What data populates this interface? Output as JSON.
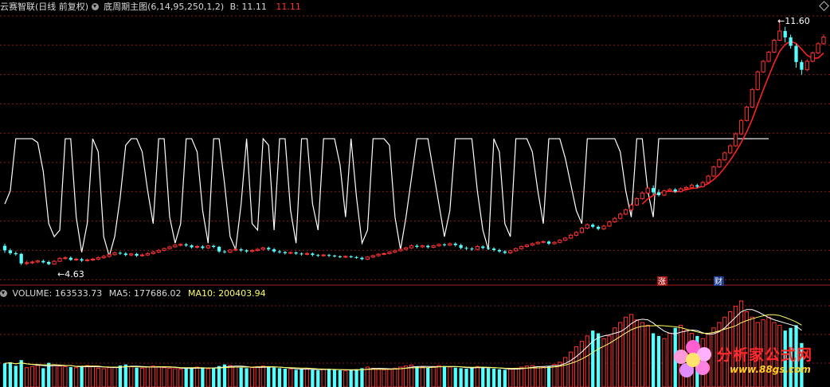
{
  "header": {
    "title": "云赛智联(日线 前复权)",
    "indicator": "底周期主图(6,14,95,250,1,2)",
    "b_label": "B: 11.11",
    "b_value": "11.11"
  },
  "volume_header": {
    "volume": "VOLUME: 163533.73",
    "ma5": "MA5: 177686.02",
    "ma10": "MA10: 200403.94"
  },
  "annotations": {
    "high": "11.60",
    "low": "4.63",
    "zhang": "涨",
    "cai": "财"
  },
  "watermark": {
    "brand": "分析家公式网",
    "site": "www.88gs.com"
  },
  "colors": {
    "up": "#ff3232",
    "down": "#54ffff",
    "grid": "#8a1a1a",
    "line_white": "#ffffff",
    "ma_red": "#ff2020",
    "ma10_text": "#ffff66"
  },
  "chart_data": {
    "type": "candlestick",
    "price_min": 4.2,
    "price_max": 11.8,
    "max_price": 11.6,
    "min_price": 4.63,
    "candles": [
      [
        5.18,
        5.05,
        5.24,
        4.98
      ],
      [
        5.05,
        4.97,
        5.1,
        4.92
      ],
      [
        4.97,
        4.94,
        5.02,
        4.9
      ],
      [
        4.95,
        4.68,
        4.98,
        4.63
      ],
      [
        4.68,
        4.7,
        4.76,
        4.63
      ],
      [
        4.7,
        4.72,
        4.76,
        4.66
      ],
      [
        4.72,
        4.75,
        4.78,
        4.69
      ],
      [
        4.75,
        4.71,
        4.79,
        4.68
      ],
      [
        4.72,
        4.66,
        4.76,
        4.63
      ],
      [
        4.66,
        4.74,
        4.78,
        4.64
      ],
      [
        4.74,
        4.82,
        4.86,
        4.72
      ],
      [
        4.82,
        4.84,
        4.88,
        4.79
      ],
      [
        4.84,
        4.78,
        4.88,
        4.75
      ],
      [
        4.78,
        4.8,
        4.84,
        4.75
      ],
      [
        4.8,
        4.76,
        4.84,
        4.72
      ],
      [
        4.76,
        4.78,
        4.82,
        4.73
      ],
      [
        4.78,
        4.8,
        4.84,
        4.75
      ],
      [
        4.8,
        4.84,
        4.88,
        4.77
      ],
      [
        4.84,
        4.88,
        4.92,
        4.81
      ],
      [
        4.88,
        4.93,
        4.96,
        4.85
      ],
      [
        4.93,
        4.98,
        5.02,
        4.9
      ],
      [
        4.98,
        4.96,
        5.02,
        4.92
      ],
      [
        4.96,
        4.92,
        5.0,
        4.88
      ],
      [
        4.92,
        4.95,
        4.98,
        4.88
      ],
      [
        4.95,
        4.9,
        4.98,
        4.86
      ],
      [
        4.9,
        4.92,
        4.96,
        4.87
      ],
      [
        4.92,
        4.96,
        5.0,
        4.89
      ],
      [
        4.96,
        5.0,
        5.04,
        4.93
      ],
      [
        5.0,
        5.05,
        5.09,
        4.97
      ],
      [
        5.05,
        5.1,
        5.13,
        5.02
      ],
      [
        5.1,
        5.15,
        5.18,
        5.07
      ],
      [
        5.15,
        5.2,
        5.23,
        5.12
      ],
      [
        5.2,
        5.22,
        5.25,
        5.16
      ],
      [
        5.22,
        5.19,
        5.26,
        5.15
      ],
      [
        5.19,
        5.14,
        5.22,
        5.1
      ],
      [
        5.14,
        5.16,
        5.2,
        5.1
      ],
      [
        5.16,
        5.12,
        5.2,
        5.08
      ],
      [
        5.12,
        5.18,
        5.21,
        5.09
      ],
      [
        5.18,
        5.15,
        5.21,
        5.11
      ],
      [
        5.15,
        5.02,
        5.18,
        4.98
      ],
      [
        5.02,
        5.0,
        5.06,
        4.96
      ],
      [
        5.0,
        5.06,
        5.09,
        4.97
      ],
      [
        5.06,
        5.08,
        5.12,
        5.03
      ],
      [
        5.08,
        5.05,
        5.12,
        5.01
      ],
      [
        5.05,
        5.02,
        5.08,
        4.98
      ],
      [
        5.02,
        5.05,
        5.08,
        4.99
      ],
      [
        5.05,
        5.08,
        5.12,
        5.02
      ],
      [
        5.08,
        5.12,
        5.15,
        5.05
      ],
      [
        5.12,
        5.08,
        5.16,
        5.04
      ],
      [
        5.08,
        5.02,
        5.12,
        4.98
      ],
      [
        5.02,
        5.0,
        5.06,
        4.96
      ],
      [
        5.0,
        4.97,
        5.03,
        4.93
      ],
      [
        4.97,
        4.99,
        5.02,
        4.94
      ],
      [
        4.99,
        4.96,
        5.02,
        4.92
      ],
      [
        4.96,
        4.94,
        4.99,
        4.9
      ],
      [
        4.94,
        4.96,
        5.0,
        4.91
      ],
      [
        4.96,
        4.92,
        4.99,
        4.88
      ],
      [
        4.92,
        4.9,
        4.95,
        4.86
      ],
      [
        4.9,
        4.92,
        4.95,
        4.87
      ],
      [
        4.92,
        4.9,
        4.95,
        4.86
      ],
      [
        4.9,
        4.88,
        4.93,
        4.85
      ],
      [
        4.88,
        4.86,
        4.91,
        4.83
      ],
      [
        4.86,
        4.88,
        4.91,
        4.83
      ],
      [
        4.88,
        4.86,
        4.91,
        4.83
      ],
      [
        4.86,
        4.84,
        4.89,
        4.81
      ],
      [
        4.84,
        4.8,
        4.87,
        4.77
      ],
      [
        4.8,
        4.86,
        4.89,
        4.77
      ],
      [
        4.86,
        4.9,
        4.93,
        4.83
      ],
      [
        4.9,
        4.94,
        4.97,
        4.87
      ],
      [
        4.94,
        4.96,
        4.99,
        4.91
      ],
      [
        4.96,
        5.0,
        5.03,
        4.93
      ],
      [
        5.0,
        5.04,
        5.07,
        4.97
      ],
      [
        5.04,
        5.08,
        5.11,
        5.01
      ],
      [
        5.08,
        5.12,
        5.15,
        5.05
      ],
      [
        5.12,
        5.18,
        5.22,
        5.09
      ],
      [
        5.18,
        5.15,
        5.22,
        5.11
      ],
      [
        5.15,
        5.18,
        5.21,
        5.12
      ],
      [
        5.18,
        5.14,
        5.21,
        5.1
      ],
      [
        5.14,
        5.18,
        5.21,
        5.11
      ],
      [
        5.18,
        5.22,
        5.25,
        5.15
      ],
      [
        5.22,
        5.2,
        5.25,
        5.16
      ],
      [
        5.2,
        5.24,
        5.27,
        5.17
      ],
      [
        5.24,
        5.2,
        5.28,
        5.16
      ],
      [
        5.2,
        5.12,
        5.24,
        5.08
      ],
      [
        5.12,
        5.1,
        5.16,
        5.06
      ],
      [
        5.1,
        5.08,
        5.14,
        5.04
      ],
      [
        5.08,
        5.16,
        5.2,
        5.05
      ],
      [
        5.16,
        5.12,
        5.19,
        5.08
      ],
      [
        5.12,
        5.1,
        5.16,
        5.06
      ],
      [
        5.1,
        5.06,
        5.14,
        5.02
      ],
      [
        5.06,
        5.02,
        5.1,
        4.98
      ],
      [
        5.02,
        4.98,
        5.06,
        4.94
      ],
      [
        4.98,
        5.04,
        5.07,
        4.95
      ],
      [
        5.04,
        5.1,
        5.13,
        5.01
      ],
      [
        5.1,
        5.16,
        5.19,
        5.07
      ],
      [
        5.16,
        5.2,
        5.23,
        5.13
      ],
      [
        5.2,
        5.24,
        5.27,
        5.17
      ],
      [
        5.24,
        5.28,
        5.31,
        5.21
      ],
      [
        5.28,
        5.3,
        5.33,
        5.25
      ],
      [
        5.3,
        5.24,
        5.33,
        5.2
      ],
      [
        5.24,
        5.28,
        5.31,
        5.21
      ],
      [
        5.28,
        5.34,
        5.37,
        5.25
      ],
      [
        5.34,
        5.4,
        5.43,
        5.31
      ],
      [
        5.4,
        5.48,
        5.52,
        5.37
      ],
      [
        5.48,
        5.56,
        5.6,
        5.45
      ],
      [
        5.56,
        5.68,
        5.72,
        5.53
      ],
      [
        5.68,
        5.78,
        5.82,
        5.65
      ],
      [
        5.78,
        5.72,
        5.82,
        5.68
      ],
      [
        5.72,
        5.66,
        5.76,
        5.62
      ],
      [
        5.66,
        5.74,
        5.78,
        5.63
      ],
      [
        5.74,
        5.86,
        5.9,
        5.71
      ],
      [
        5.86,
        5.96,
        6.0,
        5.83
      ],
      [
        5.96,
        6.08,
        6.12,
        5.93
      ],
      [
        6.08,
        6.2,
        6.24,
        6.05
      ],
      [
        6.2,
        6.34,
        6.38,
        6.17
      ],
      [
        6.34,
        6.52,
        6.56,
        6.31
      ],
      [
        6.52,
        6.68,
        6.72,
        6.49
      ],
      [
        6.68,
        6.82,
        6.86,
        6.65
      ],
      [
        6.82,
        6.7,
        6.9,
        6.62
      ],
      [
        6.7,
        6.62,
        6.78,
        6.58
      ],
      [
        6.62,
        6.74,
        6.78,
        6.59
      ],
      [
        6.74,
        6.78,
        6.82,
        6.71
      ],
      [
        6.78,
        6.72,
        6.82,
        6.68
      ],
      [
        6.72,
        6.8,
        6.84,
        6.69
      ],
      [
        6.8,
        6.84,
        6.88,
        6.77
      ],
      [
        6.84,
        6.9,
        6.94,
        6.81
      ],
      [
        6.9,
        6.86,
        6.94,
        6.82
      ],
      [
        6.86,
        6.98,
        7.02,
        6.83
      ],
      [
        6.98,
        7.16,
        7.2,
        6.95
      ],
      [
        7.16,
        7.42,
        7.46,
        7.13
      ],
      [
        7.42,
        7.62,
        7.66,
        7.39
      ],
      [
        7.62,
        7.82,
        7.86,
        7.59
      ],
      [
        7.82,
        8.02,
        8.06,
        7.79
      ],
      [
        8.02,
        8.36,
        8.4,
        7.99
      ],
      [
        8.36,
        8.74,
        8.78,
        8.33
      ],
      [
        8.74,
        9.12,
        9.16,
        8.71
      ],
      [
        9.12,
        9.62,
        9.66,
        9.09
      ],
      [
        9.62,
        10.12,
        10.16,
        9.59
      ],
      [
        10.12,
        10.42,
        10.46,
        10.09
      ],
      [
        10.42,
        10.68,
        10.72,
        10.39
      ],
      [
        10.68,
        11.02,
        11.06,
        10.65
      ],
      [
        11.02,
        11.28,
        11.6,
        10.99
      ],
      [
        11.28,
        11.1,
        11.4,
        10.96
      ],
      [
        11.1,
        10.86,
        11.18,
        10.78
      ],
      [
        10.86,
        10.4,
        10.92,
        10.24
      ],
      [
        10.4,
        10.18,
        10.46,
        10.04
      ],
      [
        10.18,
        10.42,
        10.48,
        10.14
      ],
      [
        10.42,
        10.66,
        10.7,
        10.39
      ],
      [
        10.66,
        10.92,
        10.96,
        10.63
      ],
      [
        10.92,
        11.11,
        11.18,
        10.89
      ]
    ],
    "volumes": [
      88000,
      92000,
      79000,
      100000,
      72000,
      76000,
      80000,
      70000,
      90000,
      82000,
      78000,
      76000,
      74000,
      72000,
      76000,
      80000,
      78000,
      70000,
      68000,
      72000,
      74000,
      80000,
      84000,
      76000,
      72000,
      70000,
      74000,
      78000,
      76000,
      72000,
      70000,
      68000,
      66000,
      70000,
      72000,
      74000,
      70000,
      68000,
      72000,
      78000,
      84000,
      80000,
      74000,
      72000,
      70000,
      72000,
      76000,
      78000,
      74000,
      72000,
      70000,
      68000,
      66000,
      64000,
      66000,
      68000,
      64000,
      62000,
      66000,
      68000,
      64000,
      62000,
      60000,
      62000,
      66000,
      70000,
      74000,
      70000,
      66000,
      64000,
      66000,
      70000,
      74000,
      78000,
      82000,
      76000,
      74000,
      72000,
      76000,
      80000,
      78000,
      74000,
      72000,
      70000,
      68000,
      72000,
      76000,
      74000,
      70000,
      68000,
      66000,
      64000,
      66000,
      70000,
      74000,
      78000,
      80000,
      76000,
      74000,
      78000,
      84000,
      92000,
      110000,
      130000,
      150000,
      170000,
      190000,
      210000,
      200000,
      180000,
      190000,
      220000,
      240000,
      260000,
      270000,
      250000,
      240000,
      230000,
      200000,
      190000,
      180000,
      200000,
      220000,
      230000,
      210000,
      200000,
      190000,
      180000,
      200000,
      220000,
      240000,
      260000,
      280000,
      300000,
      320000,
      280000,
      260000,
      240000,
      250000,
      260000,
      240000,
      230000,
      210000,
      220000,
      230000,
      163533
    ],
    "ma5_vol": 177686.02,
    "ma10_vol": 200403.94,
    "signal_line": {
      "high": 1,
      "low": 0,
      "values": [
        0.45,
        0.55,
        0.95,
        0.95,
        0.95,
        0.95,
        0.92,
        0.7,
        0.3,
        0.2,
        0.25,
        0.95,
        0.95,
        0.35,
        0.08,
        0.3,
        0.95,
        0.85,
        0.2,
        0.05,
        0.2,
        0.5,
        0.9,
        0.95,
        0.95,
        0.85,
        0.55,
        0.3,
        0.95,
        0.95,
        0.35,
        0.15,
        0.3,
        0.95,
        0.95,
        0.85,
        0.4,
        0.15,
        0.95,
        0.95,
        0.6,
        0.2,
        0.1,
        0.45,
        0.95,
        0.3,
        0.25,
        0.95,
        0.9,
        0.25,
        0.95,
        0.95,
        0.4,
        0.15,
        0.95,
        0.95,
        0.45,
        0.25,
        0.95,
        0.95,
        0.95,
        0.75,
        0.35,
        0.95,
        0.5,
        0.15,
        0.25,
        0.95,
        0.95,
        0.95,
        0.9,
        0.35,
        0.1,
        0.35,
        0.65,
        0.95,
        0.95,
        0.95,
        0.7,
        0.45,
        0.2,
        0.4,
        0.95,
        0.95,
        0.95,
        0.95,
        0.55,
        0.25,
        0.1,
        0.95,
        0.85,
        0.3,
        0.2,
        0.95,
        0.95,
        0.95,
        0.85,
        0.55,
        0.3,
        0.95,
        0.95,
        0.95,
        0.8,
        0.6,
        0.4,
        0.3,
        0.95,
        0.95,
        0.95,
        0.95,
        0.95,
        0.95,
        0.85,
        0.55,
        0.35,
        0.95,
        0.95,
        0.55,
        0.35,
        0.95,
        0.95,
        0.95,
        0.95,
        0.95,
        0.95,
        0.95,
        0.95,
        0.95,
        0.95,
        0.95,
        0.95,
        0.95,
        0.95,
        0.95,
        0.95,
        0.95,
        0.95,
        0.95,
        0.95,
        0.95
      ]
    }
  }
}
